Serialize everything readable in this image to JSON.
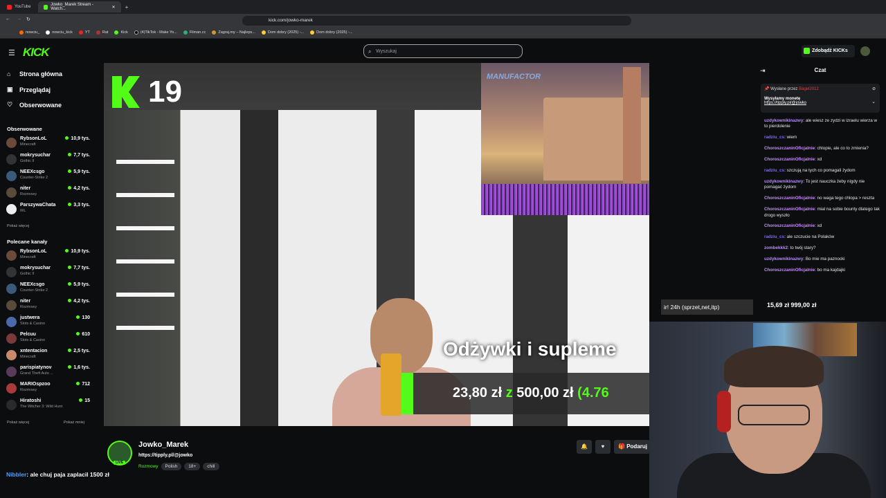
{
  "browser": {
    "tabs": [
      {
        "label": "YouTube",
        "active": false
      },
      {
        "label": "Jowko_Marek Stream - Watch...",
        "active": true
      }
    ],
    "address": "kick.com/jowko-marek",
    "bookmarks": [
      "nowciu_",
      "nowciu_kick",
      "YT",
      "Rat",
      "Kick",
      "(4)TikTok - Make Yo...",
      "Filman.cc",
      "Zagraj.my – Najleps...",
      "Dom dobry (2025) -...",
      "Dom dobry (2025) -..."
    ]
  },
  "header": {
    "logo": "KICK",
    "search_placeholder": "Wyszukaj",
    "get_kicks": "Zdobądź KICKs"
  },
  "nav": [
    {
      "label": "Strona główna",
      "icon": "home-icon"
    },
    {
      "label": "Przeglądaj",
      "icon": "browse-icon"
    },
    {
      "label": "Obserwowane",
      "icon": "heart-icon"
    }
  ],
  "followed": {
    "title": "Obserwowane",
    "channels": [
      {
        "name": "RybsonLoL",
        "category": "Minecraft",
        "viewers": "10,9 tys.",
        "color": "#6b4a3a"
      },
      {
        "name": "mokrysuchar",
        "category": "Gothic II",
        "viewers": "7,7 tys.",
        "color": "#333"
      },
      {
        "name": "NEEXcsgo",
        "category": "Counter-Strike 2",
        "viewers": "5,9 tys.",
        "color": "#3a5a7a"
      },
      {
        "name": "niter",
        "category": "Rozmowy",
        "viewers": "4,2 tys.",
        "color": "#5a4a3a"
      },
      {
        "name": "ParszywaChata",
        "category": "IRL",
        "viewers": "3,3 tys.",
        "color": "#eee"
      }
    ],
    "more": "Pokaż więcej"
  },
  "recommended": {
    "title": "Polecane kanały",
    "channels": [
      {
        "name": "RybsonLoL",
        "category": "Minecraft",
        "viewers": "10,9 tys.",
        "color": "#6b4a3a"
      },
      {
        "name": "mokrysuchar",
        "category": "Gothic II",
        "viewers": "7,7 tys.",
        "color": "#333"
      },
      {
        "name": "NEEXcsgo",
        "category": "Counter-Strike 2",
        "viewers": "5,9 tys.",
        "color": "#3a5a7a"
      },
      {
        "name": "niter",
        "category": "Rozmowy",
        "viewers": "4,2 tys.",
        "color": "#5a4a3a"
      },
      {
        "name": "justwera",
        "category": "Slots & Casino",
        "viewers": "130",
        "color": "#4a6aa8"
      },
      {
        "name": "Pelcuu",
        "category": "Slots & Casino",
        "viewers": "610",
        "color": "#7a3a3a"
      },
      {
        "name": "xntentacion",
        "category": "Minecraft",
        "viewers": "2,5 tys.",
        "color": "#c88a6a"
      },
      {
        "name": "parispiatynov",
        "category": "Grand Theft Auto ...",
        "viewers": "1,6 tys.",
        "color": "#5a3a5a"
      },
      {
        "name": "MARIOspzoo",
        "category": "Rozmowy",
        "viewers": "712",
        "color": "#a83a3a"
      },
      {
        "name": "Hiratoshi",
        "category": "The Witcher 3: Wild Hunt",
        "viewers": "15",
        "color": "#2a2a2a"
      }
    ],
    "more": "Pokaż więcej",
    "less": "Pokaż mniej"
  },
  "player": {
    "kick_count": "19",
    "overlay_title": "MANUFACTOR",
    "supplement_text": "Odżywki i supleme",
    "goal": {
      "current": "23,80 zł",
      "sep": "z",
      "target": "500,00 zł",
      "percent": "(4.76",
      "fill": 0.0476
    },
    "ir_text": "ir! 24h (sprzet,net,itp)"
  },
  "chat": {
    "title": "Czat",
    "pinned": {
      "by_label": "Wysłane przez",
      "by_user": "Bagel2012",
      "message": "Wysyłamy monetę",
      "link": "https://tipply.pl/@jowko"
    },
    "messages": [
      {
        "user": "uzdykownikinazwy",
        "color": "#b98cff",
        "text": "ale wiesz ze zydzi w izraelu wierza w to pierdolenie"
      },
      {
        "user": "radziu_cs",
        "color": "#7a6cff",
        "text": "wiem"
      },
      {
        "user": "ChoroszczaninOficjalnie",
        "color": "#c98cff",
        "text": "chlopie, ale co to zmienia?"
      },
      {
        "user": "ChoroszczaninOficjalnie",
        "color": "#c98cff",
        "text": "xd"
      },
      {
        "user": "radziu_cs",
        "color": "#7a6cff",
        "text": "szczują na tych co pomagali żydom"
      },
      {
        "user": "uzdykownikinazwy",
        "color": "#b98cff",
        "text": "To jest nauczka żeby nigdy nie pomagać żydom"
      },
      {
        "user": "ChoroszczaninOficjalnie",
        "color": "#c98cff",
        "text": "no waga tego chlopa > reszta"
      },
      {
        "user": "ChoroszczaninOficjalnie",
        "color": "#c98cff",
        "text": "mial na sobie bounty dlatego tak drogo wyszło"
      },
      {
        "user": "ChoroszczaninOficjalnie",
        "color": "#c98cff",
        "text": "xd"
      },
      {
        "user": "radziu_cs",
        "color": "#7a6cff",
        "text": "ale szczucie na Polaków"
      },
      {
        "user": "zombekkk2",
        "color": "#b98cff",
        "text": "to twój stary?"
      },
      {
        "user": "uzdykownikinazwy",
        "color": "#b98cff",
        "text": "Bo mie ma paznocki"
      },
      {
        "user": "ChoroszczaninOficjalnie",
        "color": "#c98cff",
        "text": "bo ma kajdajki"
      }
    ],
    "goal_overlay": "15,69 zł   999,00 zł"
  },
  "stream": {
    "name": "Jowko_Marek",
    "link": "https://tipply.pl/@jowko",
    "live": "LIVE",
    "category": "Rozmowy",
    "tags": [
      "Polish",
      "18+",
      "chill"
    ],
    "gift_label": "Podaruj"
  },
  "bottom_chat": {
    "user": "Nibbler",
    "text": ": ale chuj paja zaplacil 1500 zł"
  }
}
